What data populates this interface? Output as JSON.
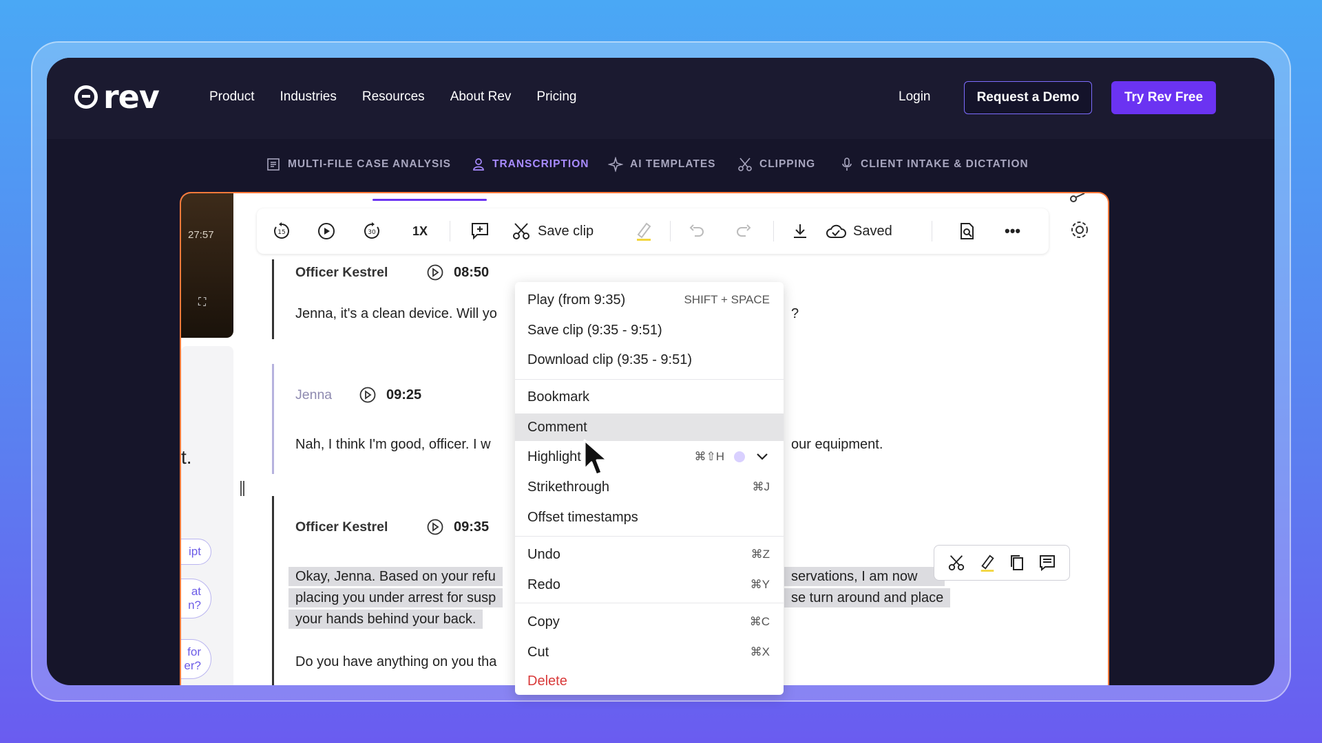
{
  "brand": {
    "logo_text": "rev"
  },
  "nav": {
    "links": [
      "Product",
      "Industries",
      "Resources",
      "About Rev",
      "Pricing"
    ],
    "login": "Login",
    "request_demo": "Request a Demo",
    "try_free": "Try Rev Free"
  },
  "subnav": {
    "items": [
      {
        "label": "MULTI-FILE CASE ANALYSIS",
        "icon": "document-scan-icon",
        "active": false
      },
      {
        "label": "TRANSCRIPTION",
        "icon": "person-icon",
        "active": true
      },
      {
        "label": "AI TEMPLATES",
        "icon": "sparkle-icon",
        "active": false
      },
      {
        "label": "CLIPPING",
        "icon": "scissors-icon",
        "active": false
      },
      {
        "label": "CLIENT INTAKE & DICTATION",
        "icon": "microphone-icon",
        "active": false
      }
    ]
  },
  "video": {
    "time": "27:57"
  },
  "left_panel": {
    "partial_text": "t.",
    "pills": [
      "ipt",
      "at\nn?",
      "for\ner?"
    ]
  },
  "toolbar": {
    "rewind_label": "15",
    "forward_label": "30",
    "speed": "1X",
    "save_clip": "Save clip",
    "saved": "Saved"
  },
  "transcript": {
    "blocks": [
      {
        "speaker": "Officer Kestrel",
        "time": "08:50",
        "lines": [
          "Jenna, it's a clean device. Will yo"
        ],
        "line_tail": "?"
      },
      {
        "speaker": "Jenna",
        "time": "09:25",
        "lines": [
          "Nah, I think I'm good, officer. I w"
        ],
        "line_tail": "our equipment."
      },
      {
        "speaker": "Officer Kestrel",
        "time": "09:35",
        "lines": [
          "Okay, Jenna. Based on your refu",
          "placing you under arrest for susp",
          "your hands behind your back."
        ],
        "line_tails": [
          "servations, I am now",
          "se turn around and place"
        ],
        "extra_line": "Do you have anything on you tha"
      }
    ]
  },
  "context_menu": {
    "items": [
      {
        "label": "Play (from 9:35)",
        "shortcut": "SHIFT + SPACE"
      },
      {
        "label": "Save clip (9:35 - 9:51)",
        "shortcut": ""
      },
      {
        "label": "Download clip (9:35 - 9:51)",
        "shortcut": ""
      },
      {
        "label": "Bookmark",
        "shortcut": ""
      },
      {
        "label": "Comment",
        "shortcut": ""
      },
      {
        "label": "Highlight",
        "shortcut": "⌘⇧H"
      },
      {
        "label": "Strikethrough",
        "shortcut": "⌘J"
      },
      {
        "label": "Offset timestamps",
        "shortcut": ""
      },
      {
        "label": "Undo",
        "shortcut": "⌘Z"
      },
      {
        "label": "Redo",
        "shortcut": "⌘Y"
      },
      {
        "label": "Copy",
        "shortcut": "⌘C"
      },
      {
        "label": "Cut",
        "shortcut": "⌘X"
      },
      {
        "label": "Delete",
        "shortcut": ""
      }
    ]
  },
  "colors": {
    "accent": "#6b33f2",
    "highlight_dot": "#d9d0ff",
    "danger": "#d93a3a"
  }
}
